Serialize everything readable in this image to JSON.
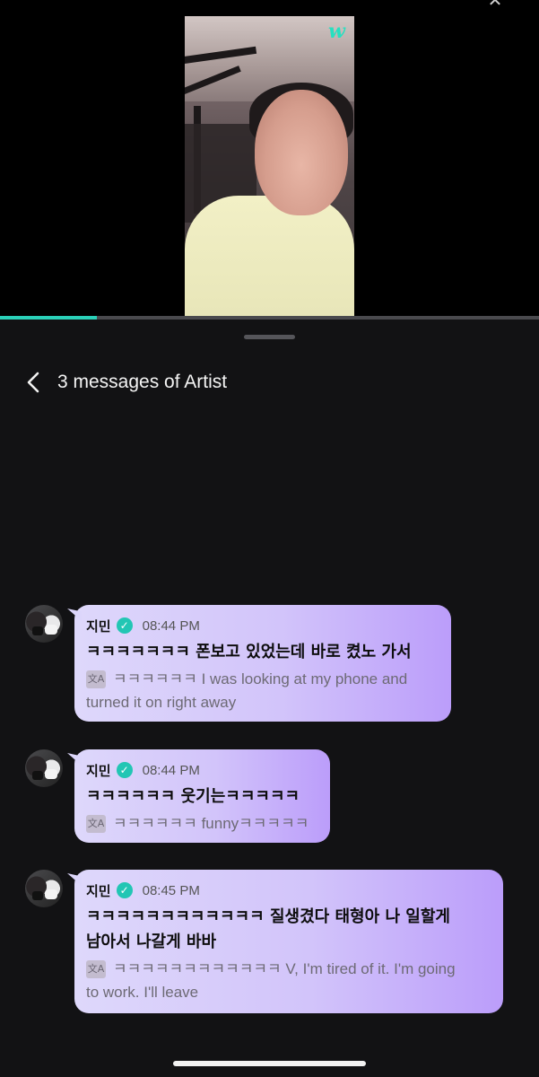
{
  "video": {
    "logo": "w",
    "progress": 0.18
  },
  "header": {
    "title": "3 messages of Artist"
  },
  "messages": [
    {
      "sender": "지민",
      "time": "08:44 PM",
      "text_lines": [
        "ㅋㅋㅋㅋㅋㅋㅋ 폰보고 있었는데 바로 켰노 가서"
      ],
      "translation_lines": [
        "ㅋㅋㅋㅋㅋㅋ I was looking at my phone and",
        "turned it on right away"
      ]
    },
    {
      "sender": "지민",
      "time": "08:44 PM",
      "text_lines": [
        "ㅋㅋㅋㅋㅋㅋ 웃기는ㅋㅋㅋㅋㅋ"
      ],
      "translation_lines": [
        "ㅋㅋㅋㅋㅋㅋ funnyㅋㅋㅋㅋㅋ"
      ]
    },
    {
      "sender": "지민",
      "time": "08:45 PM",
      "text_lines": [
        "ㅋㅋㅋㅋㅋㅋㅋㅋㅋㅋㅋㅋ 질생겼다 태형아 나 일할게",
        "남아서 나갈게 바바"
      ],
      "translation_lines": [
        "ㅋㅋㅋㅋㅋㅋㅋㅋㅋㅋㅋㅋ V, I'm tired of it. I'm going",
        "to work. I'll leave"
      ]
    }
  ],
  "icons": {
    "back": "chevron-left-icon",
    "verified": "verified-badge-icon",
    "translate": "translate-icon",
    "close": "close-icon"
  },
  "colors": {
    "accent": "#2ad0b8",
    "bubble_start": "#ded8fb",
    "bubble_end": "#bb9dfa",
    "background": "#121214"
  }
}
